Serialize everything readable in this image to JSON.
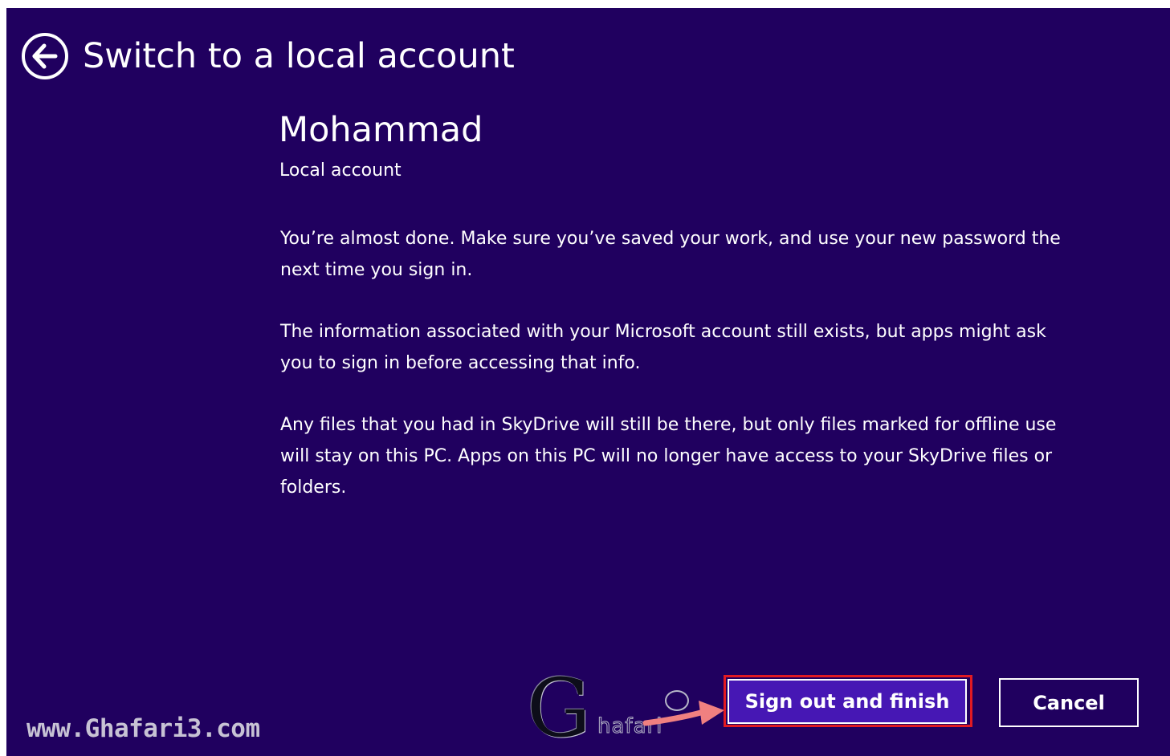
{
  "header": {
    "title": "Switch to a local account",
    "back_icon": "back-arrow-circle-icon"
  },
  "account": {
    "name": "Mohammad",
    "type": "Local account"
  },
  "message": {
    "paragraphs": [
      "You’re almost done. Make sure you’ve saved your work, and use your new password the next time you sign in.",
      "The information associated with your Microsoft account still exists, but apps might ask you to sign in before accessing that info.",
      "Any files that you had in SkyDrive will still be there, but only files marked for offline use will stay on this PC. Apps on this PC will no longer have access to your SkyDrive files or folders."
    ]
  },
  "buttons": {
    "primary_label": "Sign out and finish",
    "cancel_label": "Cancel"
  },
  "watermark": {
    "url": "www.Ghafari3.com",
    "logo_letter": "G",
    "logo_text": "hafari"
  },
  "colors": {
    "background": "#20005f",
    "primary_button": "#4617b4",
    "highlight_border": "#e11a22",
    "annotation_arrow": "#f08080"
  }
}
